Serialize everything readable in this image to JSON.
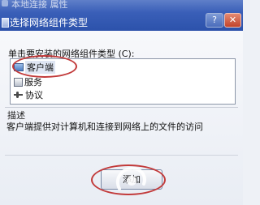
{
  "background_window": {
    "title": "本地连接 属性"
  },
  "dialog": {
    "title": "选择网络组件类型",
    "help_label": "?",
    "close_label": "✕",
    "instruction": "单击要安装的网络组件类型 (C):",
    "component_types": [
      {
        "label": "客户端",
        "icon": "client-icon",
        "selected": true
      },
      {
        "label": "服务",
        "icon": "service-icon",
        "selected": false
      },
      {
        "label": "协议",
        "icon": "protocol-icon",
        "selected": false
      }
    ],
    "description": {
      "label": "描述",
      "text": "客户端提供对计算机和连接到网络上的文件的访问"
    },
    "ok_button_label": "添加"
  },
  "annotations": {
    "circle_color": "#c23a3a"
  }
}
